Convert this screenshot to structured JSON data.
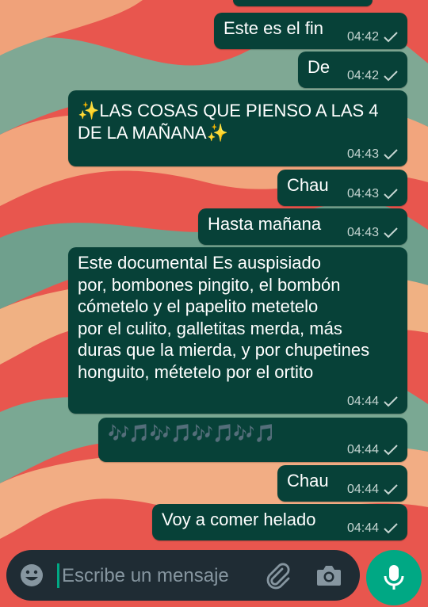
{
  "messages": [
    {
      "text": "Este es el fin",
      "time": "04:42"
    },
    {
      "text": "De",
      "time": "04:42"
    },
    {
      "text": "✨LAS COSAS QUE PIENSO A LAS 4\nDE LA MAÑANA✨",
      "time": "04:43"
    },
    {
      "text": "Chau",
      "time": "04:43"
    },
    {
      "text": "Hasta mañana",
      "time": "04:43"
    },
    {
      "text": "Este documental Es auspisiado\npor, bombones pingito, el bombón\ncómetelo y el papelito metetelo\npor el culito, galletitas merda, más\nduras que la mierda, y por chupetines\nhonguito, métetelo por el ortito",
      "time": "04:44"
    },
    {
      "text": "🎶🎵🎶🎵🎶🎵🎶🎵",
      "time": "04:44"
    },
    {
      "text": "Chau",
      "time": "04:44"
    },
    {
      "text": "Voy a comer helado",
      "time": "04:44"
    }
  ],
  "input": {
    "placeholder": "Escribe un mensaje"
  },
  "icons": {
    "emoji": "smiley-icon",
    "attach": "paperclip-icon",
    "camera": "camera-icon",
    "mic": "microphone-icon",
    "status": "single-check-icon"
  },
  "colors": {
    "bubble": "#074138",
    "accent": "#00a884",
    "input_bar": "#1f2c34"
  }
}
